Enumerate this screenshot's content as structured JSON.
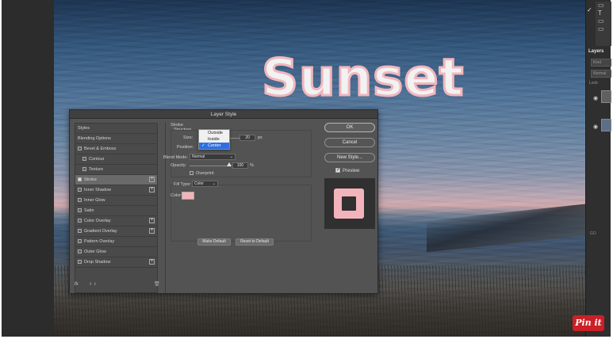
{
  "canvas": {
    "text": "Sunset",
    "text_color": "#f2f2f2",
    "stroke_color": "#f1b6bd"
  },
  "right_panel": {
    "tools": [
      "▭",
      "T",
      "▭",
      "▭"
    ],
    "layers_tab": "Layers",
    "kind_placeholder": "Kind",
    "blend": "Normal",
    "lock": "Lock:",
    "group_label": "GO"
  },
  "dialog": {
    "title": "Layer Style",
    "styles": [
      {
        "label": "Styles",
        "check": false,
        "has_cb": false,
        "plus": false,
        "indent": false,
        "selected": false
      },
      {
        "label": "Blending Options",
        "check": false,
        "has_cb": false,
        "plus": false,
        "indent": false,
        "selected": false
      },
      {
        "label": "Bevel & Emboss",
        "check": false,
        "has_cb": true,
        "plus": false,
        "indent": false,
        "selected": false
      },
      {
        "label": "Contour",
        "check": false,
        "has_cb": true,
        "plus": false,
        "indent": true,
        "selected": false
      },
      {
        "label": "Texture",
        "check": false,
        "has_cb": true,
        "plus": false,
        "indent": true,
        "selected": false
      },
      {
        "label": "Stroke",
        "check": true,
        "has_cb": true,
        "plus": true,
        "indent": false,
        "selected": true
      },
      {
        "label": "Inner Shadow",
        "check": false,
        "has_cb": true,
        "plus": true,
        "indent": false,
        "selected": false
      },
      {
        "label": "Inner Glow",
        "check": false,
        "has_cb": true,
        "plus": false,
        "indent": false,
        "selected": false
      },
      {
        "label": "Satin",
        "check": false,
        "has_cb": true,
        "plus": false,
        "indent": false,
        "selected": false
      },
      {
        "label": "Color Overlay",
        "check": false,
        "has_cb": true,
        "plus": true,
        "indent": false,
        "selected": false
      },
      {
        "label": "Gradient Overlay",
        "check": false,
        "has_cb": true,
        "plus": true,
        "indent": false,
        "selected": false
      },
      {
        "label": "Pattern Overlay",
        "check": false,
        "has_cb": true,
        "plus": false,
        "indent": false,
        "selected": false
      },
      {
        "label": "Outer Glow",
        "check": false,
        "has_cb": true,
        "plus": false,
        "indent": false,
        "selected": false
      },
      {
        "label": "Drop Shadow",
        "check": false,
        "has_cb": true,
        "plus": true,
        "indent": false,
        "selected": false
      }
    ],
    "fx": "fx",
    "stroke": {
      "heading": "Stroke",
      "structure": "Structure",
      "size_label": "Size:",
      "size_value": "20",
      "size_unit": "px",
      "position_label": "Position:",
      "position_options": [
        "Outside",
        "Inside",
        "Center"
      ],
      "position_selected": "Center",
      "blend_label": "Blend Mode:",
      "blend_value": "Normal",
      "opacity_label": "Opacity:",
      "opacity_value": "100",
      "opacity_unit": "%",
      "overprint_label": "Overprint",
      "fill_type_label": "Fill Type:",
      "fill_type_value": "Color",
      "color_label": "Color:",
      "color_value": "#f3b3b8",
      "make_default": "Make Default",
      "reset_default": "Reset to Default"
    },
    "buttons": {
      "ok": "OK",
      "cancel": "Cancel",
      "new_style": "New Style..."
    },
    "preview_label": "Preview",
    "preview_checked": true,
    "preview_color": "#f2b4ba"
  },
  "pinterest": {
    "label": "Pin it",
    "color": "#cb2027"
  }
}
